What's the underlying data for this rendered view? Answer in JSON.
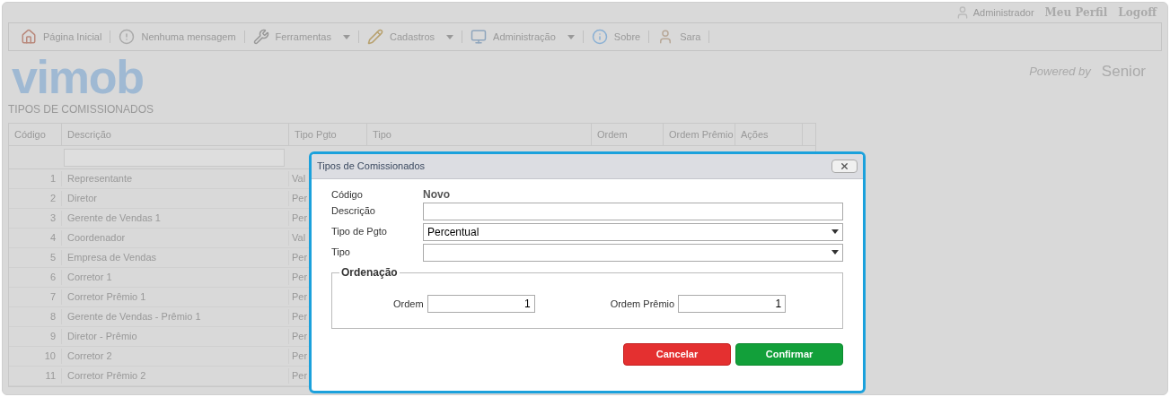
{
  "user_bar": {
    "user": "Administrador",
    "links": [
      "Meu Perfil",
      "Logoff"
    ]
  },
  "toolbar": [
    {
      "label": "Página Inicial",
      "dropdown": false
    },
    {
      "label": "Nenhuma mensagem",
      "dropdown": false
    },
    {
      "label": "Ferramentas",
      "dropdown": true
    },
    {
      "label": "Cadastros",
      "dropdown": true
    },
    {
      "label": "Administração",
      "dropdown": true
    },
    {
      "label": "Sobre",
      "dropdown": false
    },
    {
      "label": "Sara",
      "dropdown": false
    }
  ],
  "logo": "vimob",
  "powered_by": {
    "prefix": "Powered by",
    "brand": "Senior"
  },
  "page_title": "TIPOS DE COMISSIONADOS",
  "table": {
    "columns": [
      "Código",
      "Descrição",
      "Tipo Pgto",
      "Tipo",
      "Ordem",
      "Ordem Prêmio",
      "Ações"
    ],
    "rows": [
      [
        "1",
        "Representante",
        "Val"
      ],
      [
        "2",
        "Diretor",
        "Per"
      ],
      [
        "3",
        "Gerente de Vendas 1",
        "Per"
      ],
      [
        "4",
        "Coordenador",
        "Val"
      ],
      [
        "5",
        "Empresa de Vendas",
        "Per"
      ],
      [
        "6",
        "Corretor 1",
        "Per"
      ],
      [
        "7",
        "Corretor Prêmio 1",
        "Per"
      ],
      [
        "8",
        "Gerente de Vendas - Prêmio 1",
        "Per"
      ],
      [
        "9",
        "Diretor - Prêmio",
        "Per"
      ],
      [
        "10",
        "Corretor 2",
        "Per"
      ],
      [
        "11",
        "Corretor Prêmio 2",
        "Per"
      ]
    ]
  },
  "dialog": {
    "title": "Tipos de Comissionados",
    "codigo_label": "Código",
    "codigo_value": "Novo",
    "fields": [
      {
        "label": "Descrição",
        "kind": "text"
      },
      {
        "label": "Tipo de Pgto",
        "kind": "select",
        "value": "Percentual"
      },
      {
        "label": "Tipo",
        "kind": "select"
      }
    ],
    "group": {
      "title": "Ordenação",
      "fields": [
        {
          "label": "Ordem",
          "value": "1"
        },
        {
          "label": "Ordem Prêmio",
          "value": "1"
        }
      ]
    },
    "buttons": [
      {
        "label": "Cancelar",
        "kind": "cancel"
      },
      {
        "label": "Confirmar",
        "kind": "confirm"
      }
    ]
  }
}
